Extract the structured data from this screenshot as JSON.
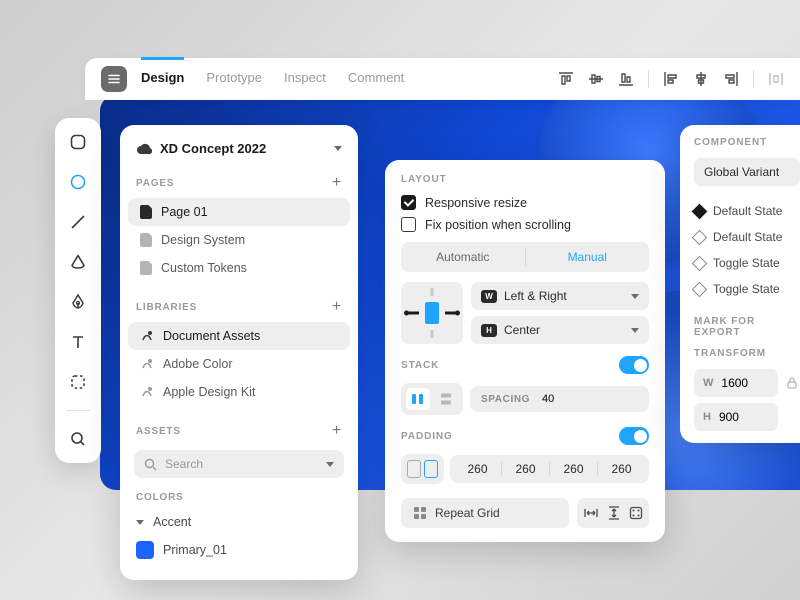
{
  "topbar": {
    "tabs": [
      "Design",
      "Prototype",
      "Inspect",
      "Comment"
    ],
    "activeTab": 0
  },
  "project": {
    "name": "XD Concept 2022"
  },
  "pages": {
    "heading": "PAGES",
    "items": [
      "Page 01",
      "Design System",
      "Custom Tokens"
    ],
    "selected": 0
  },
  "libraries": {
    "heading": "LIBRARIES",
    "items": [
      "Document Assets",
      "Adobe Color",
      "Apple Design Kit"
    ],
    "selected": 0
  },
  "assets": {
    "heading": "ASSETS",
    "searchPlaceholder": "Search"
  },
  "colors": {
    "heading": "COLORS",
    "items": [
      {
        "name": "Accent",
        "swatch": null
      },
      {
        "name": "Primary_01",
        "swatch": "#1e62ff"
      }
    ]
  },
  "layout": {
    "heading": "LAYOUT",
    "responsiveLabel": "Responsive resize",
    "responsiveOn": true,
    "fixLabel": "Fix position when scrolling",
    "fixOn": false,
    "modes": [
      "Automatic",
      "Manual"
    ],
    "modeActive": 1,
    "horizontal": "Left & Right",
    "hBadge": "W",
    "vertical": "Center",
    "vBadge": "H",
    "stackHeading": "STACK",
    "stackOn": true,
    "spacingLabel": "SPACING",
    "spacingValue": "40",
    "paddingHeading": "PADDING",
    "paddingOn": true,
    "paddingValues": [
      "260",
      "260",
      "260",
      "260"
    ],
    "repeatGridLabel": "Repeat Grid"
  },
  "component": {
    "heading": "COMPONENT",
    "globalVariant": "Global Variant",
    "states": [
      {
        "label": "Default State",
        "active": true
      },
      {
        "label": "Default State",
        "active": false
      },
      {
        "label": "Toggle State",
        "active": false
      },
      {
        "label": "Toggle State",
        "active": false
      }
    ],
    "exportHeading": "MARK FOR EXPORT",
    "transformHeading": "TRANSFORM",
    "width": "1600",
    "height": "900"
  }
}
